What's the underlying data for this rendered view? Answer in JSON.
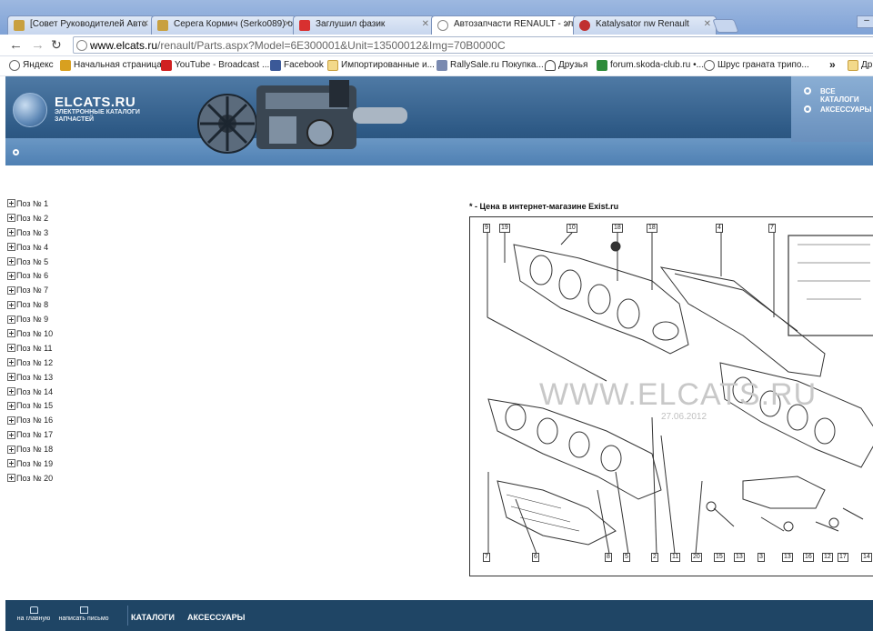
{
  "browser": {
    "tabs": [
      {
        "title": "[Совет Руководителей Авто",
        "active": false
      },
      {
        "title": "Серега Кормич (Serko089) от",
        "active": false
      },
      {
        "title": "Заглушил фазик",
        "active": false
      },
      {
        "title": "Автозапчасти RENAULT - эле",
        "active": true
      },
      {
        "title": "Katalysator nw Renault",
        "active": false
      }
    ],
    "url_host": "www.elcats.ru",
    "url_path": "/renault/Parts.aspx?Model=6E300001&Unit=13500012&Img=70B0000C",
    "bookmarks": [
      "Яндекс",
      "Начальная страница",
      "YouTube - Broadcast ...",
      "Facebook",
      "Импортированные и...",
      "RallySale.ru Покупка...",
      "Друзья",
      "forum.skoda-club.ru •...",
      "Шрус граната трипо...",
      "Др"
    ],
    "bookmarks_more": "»"
  },
  "site": {
    "logo_title": "ELCATS.RU",
    "logo_subtitle": "ЭЛЕКТРОННЫЕ КАТАЛОГИ ЗАПЧАСТЕЙ",
    "menu": [
      "ВСЕ КАТАЛОГИ",
      "АКСЕССУАРЫ"
    ]
  },
  "positions": [
    "Поз № 1",
    "Поз № 2",
    "Поз № 3",
    "Поз № 4",
    "Поз № 5",
    "Поз № 6",
    "Поз № 7",
    "Поз № 8",
    "Поз № 9",
    "Поз № 10",
    "Поз № 11",
    "Поз № 12",
    "Поз № 13",
    "Поз № 14",
    "Поз № 15",
    "Поз № 16",
    "Поз № 17",
    "Поз № 18",
    "Поз № 19",
    "Поз № 20"
  ],
  "diagram": {
    "price_note": "* - Цена в интернет-магазине Exist.ru",
    "watermark": "WWW.ELCATS.RU",
    "watermark_date": "27.06.2012",
    "top_callouts": [
      "9",
      "19",
      "10",
      "18",
      "18",
      "4",
      "7"
    ],
    "bottom_callouts": [
      "7",
      "6",
      "8",
      "5",
      "2",
      "11",
      "20",
      "15",
      "13",
      "3",
      "13",
      "16",
      "12",
      "17",
      "14"
    ]
  },
  "footer": {
    "home": "на главную",
    "mail": "написать письмо",
    "links": [
      "КАТАЛОГИ",
      "АКСЕССУАРЫ"
    ]
  }
}
